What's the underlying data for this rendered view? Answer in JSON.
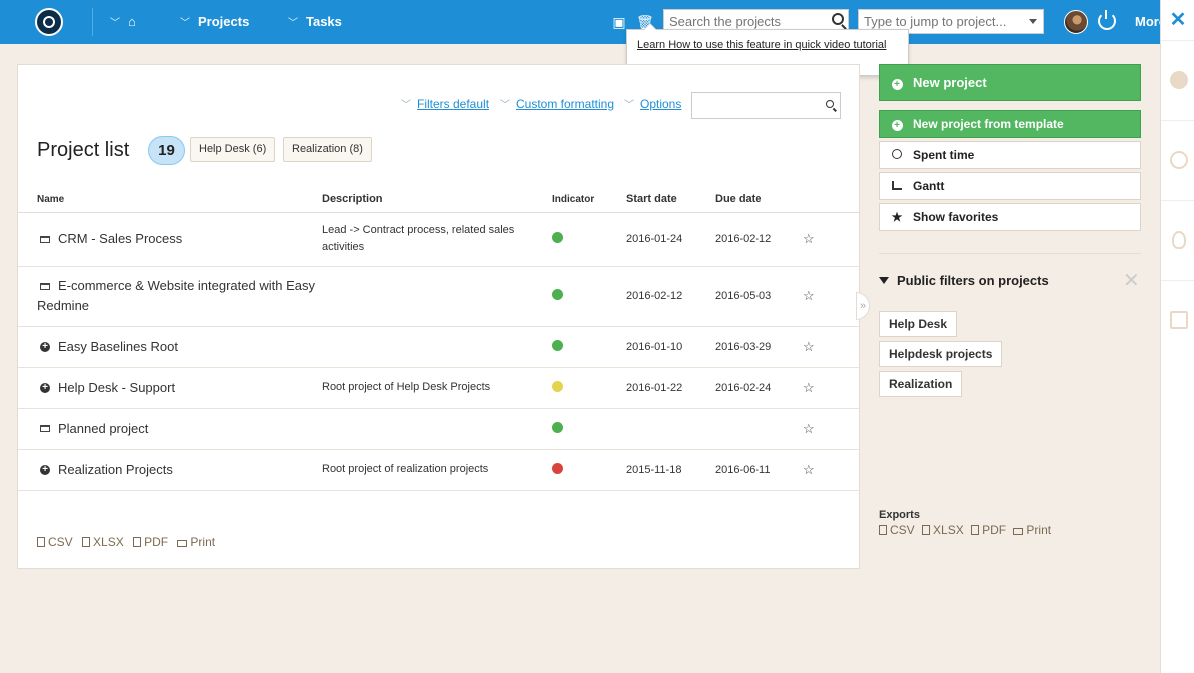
{
  "topbar": {
    "nav": [
      "Projects",
      "Tasks"
    ],
    "search_placeholder": "Search the projects",
    "jump_placeholder": "Type to jump to project...",
    "more_label": "More"
  },
  "tooltip": {
    "text": "Learn How to use this feature in quick video tutorial"
  },
  "toolbar": {
    "filters": "Filters default",
    "formatting": "Custom formatting",
    "options": "Options"
  },
  "list": {
    "title": "Project list",
    "count": "19",
    "tags": [
      "Help Desk (6)",
      "Realization (8)"
    ],
    "columns": {
      "name": "Name",
      "description": "Description",
      "indicator": "Indicator",
      "start": "Start date",
      "due": "Due date"
    },
    "rows": [
      {
        "icon": "folder-icon",
        "name": "CRM - Sales Process",
        "desc": "Lead -> Contract process, related sales activities",
        "indicator": "#4caf50",
        "start": "2016-01-24",
        "due": "2016-02-12"
      },
      {
        "icon": "folder-icon",
        "name": "E-commerce & Website integrated with Easy Redmine",
        "desc": "",
        "indicator": "#4caf50",
        "start": "2016-02-12",
        "due": "2016-05-03"
      },
      {
        "icon": "plus-circle-icon",
        "name": "Easy Baselines Root",
        "desc": "",
        "indicator": "#4caf50",
        "start": "2016-01-10",
        "due": "2016-03-29"
      },
      {
        "icon": "plus-circle-icon",
        "name": "Help Desk - Support",
        "desc": "Root project of Help Desk Projects",
        "indicator": "#e6d34c",
        "start": "2016-01-22",
        "due": "2016-02-24"
      },
      {
        "icon": "folder-icon",
        "name": "Planned project",
        "desc": "",
        "indicator": "#4caf50",
        "start": "",
        "due": ""
      },
      {
        "icon": "plus-circle-icon",
        "name": "Realization Projects",
        "desc": "Root project of realization projects",
        "indicator": "#d9433d",
        "start": "2015-11-18",
        "due": "2016-06-11"
      }
    ]
  },
  "exports": {
    "csv": "CSV",
    "xlsx": "XLSX",
    "pdf": "PDF",
    "print": "Print",
    "title": "Exports"
  },
  "sidebar": {
    "new_project": "New project",
    "new_from_template": "New project from template",
    "spent_time": "Spent time",
    "gantt": "Gantt",
    "favorites": "Show favorites",
    "public_filters_title": "Public filters on projects",
    "public_filters": [
      "Help Desk",
      "Helpdesk projects",
      "Realization"
    ]
  },
  "colors": {
    "accent": "#1e8fd6",
    "green": "#52b760",
    "background": "#f4ede5"
  }
}
